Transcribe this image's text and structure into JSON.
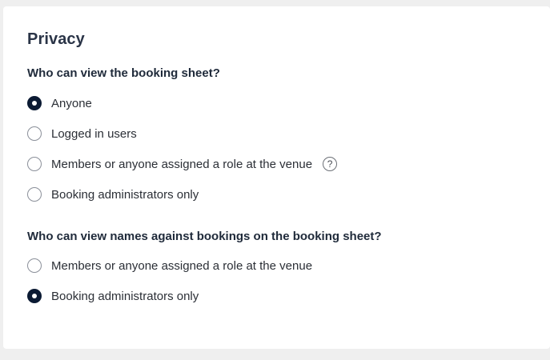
{
  "section": {
    "title": "Privacy"
  },
  "booking_sheet_visibility": {
    "question": "Who can view the booking sheet?",
    "options": [
      {
        "label": "Anyone",
        "selected": true
      },
      {
        "label": "Logged in users",
        "selected": false
      },
      {
        "label": "Members or anyone assigned a role at the venue",
        "selected": false,
        "help_icon": "question-circle-icon",
        "help_symbol": "?"
      },
      {
        "label": "Booking administrators only",
        "selected": false
      }
    ]
  },
  "names_visibility": {
    "question": "Who can view names against bookings on the booking sheet?",
    "options": [
      {
        "label": "Members or anyone assigned a role at the venue",
        "selected": false
      },
      {
        "label": "Booking administrators only",
        "selected": true
      }
    ]
  },
  "colors": {
    "radio_selected": "#0b1a33",
    "title": "#2a3447",
    "background": "#efefef",
    "card": "#ffffff"
  }
}
